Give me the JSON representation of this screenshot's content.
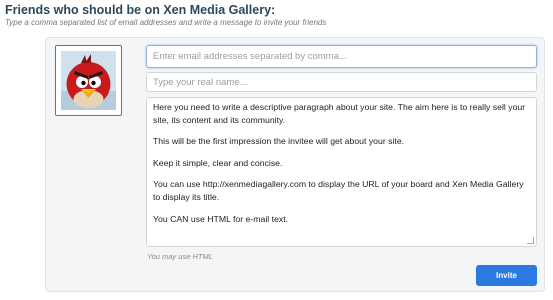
{
  "header": {
    "title": "Friends who should be on Xen Media Gallery:",
    "subtitle": "Type a comma separated list of email addresses and write a message to invite your friends"
  },
  "avatar": {
    "icon": "angry-bird-avatar-icon"
  },
  "form": {
    "email_placeholder": "Enter email addresses separated by comma...",
    "email_value": "",
    "name_placeholder": "Type your real name...",
    "name_value": "",
    "message_paragraphs": [
      "Here you need to write a descriptive paragraph about your site. The aim here is to really sell your site, its content and its community.",
      "This will be the first impression the invitee will get about your site.",
      "Keep it simple, clear and concise.",
      "You can use http://xenmediagallery.com to display the URL of your board and Xen Media Gallery to display its title.",
      "You CAN use HTML for e-mail text."
    ],
    "hint": "You may use HTML",
    "invite_label": "Invite"
  },
  "colors": {
    "title": "#2b485c",
    "button": "#2a7ae2",
    "focus_border": "#8fb3de",
    "panel_bg": "#f4f5f6"
  }
}
